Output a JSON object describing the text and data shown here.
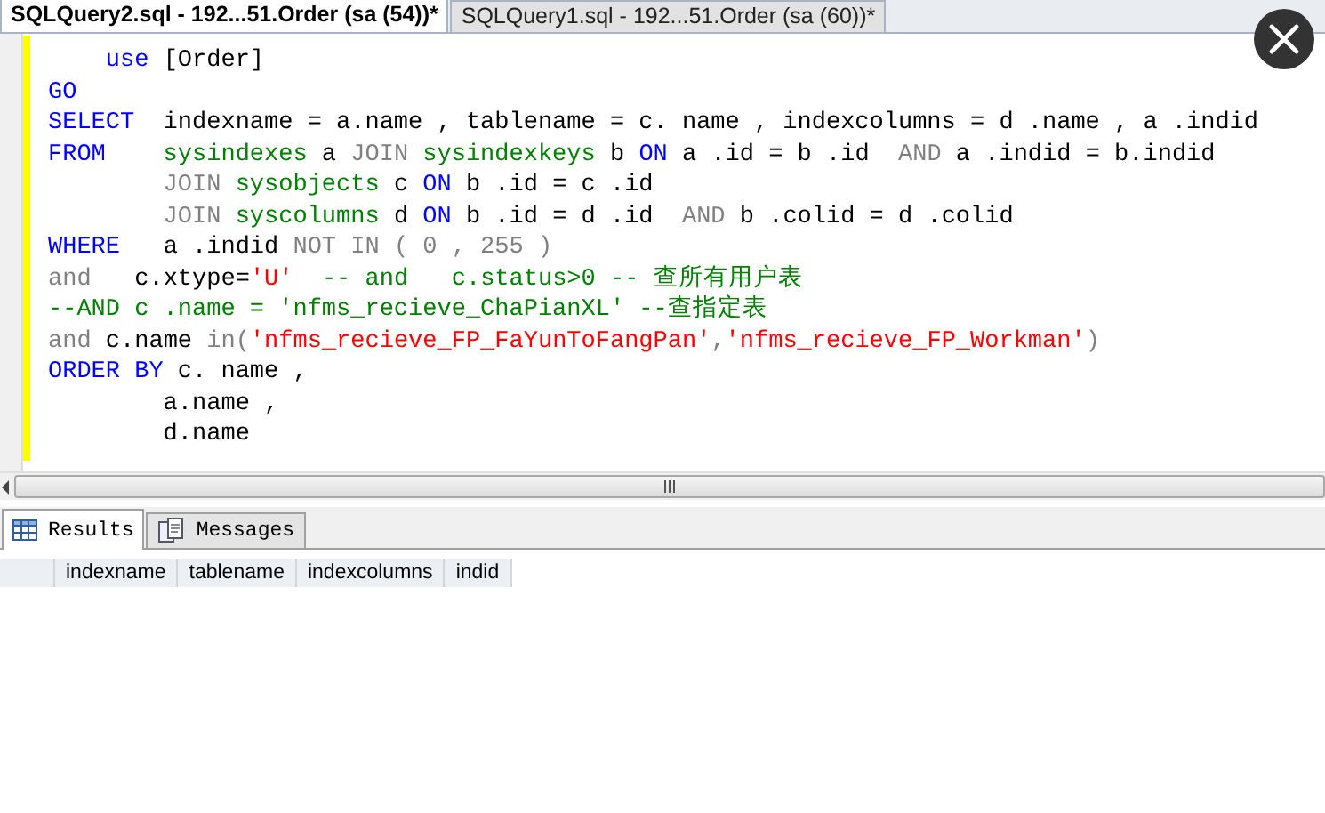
{
  "tabs": [
    {
      "label": "SQLQuery2.sql - 192...51.Order (sa (54))*",
      "selected": true
    },
    {
      "label": "SQLQuery1.sql - 192...51.Order (sa (60))*",
      "selected": false
    }
  ],
  "editor": {
    "lines": [
      [
        {
          "kind": "keyword",
          "text": "    use"
        },
        {
          "kind": "plain",
          "text": " [Order]"
        }
      ],
      [
        {
          "kind": "keyword",
          "text": "GO"
        }
      ],
      [
        {
          "kind": "keyword",
          "text": "SELECT"
        },
        {
          "kind": "plain",
          "text": "  indexname = a.name , tablename = c. name , indexcolumns = d .name , a .indid"
        }
      ],
      [
        {
          "kind": "keyword",
          "text": "FROM"
        },
        {
          "kind": "object",
          "text": "    sysindexes"
        },
        {
          "kind": "plain",
          "text": " a "
        },
        {
          "kind": "operator",
          "text": "JOIN"
        },
        {
          "kind": "object",
          "text": " sysindexkeys"
        },
        {
          "kind": "plain",
          "text": " b "
        },
        {
          "kind": "keyword",
          "text": "ON"
        },
        {
          "kind": "plain",
          "text": " a .id = b .id  "
        },
        {
          "kind": "operator",
          "text": "AND"
        },
        {
          "kind": "plain",
          "text": " a .indid = b.indid"
        }
      ],
      [
        {
          "kind": "operator",
          "text": "        JOIN"
        },
        {
          "kind": "object",
          "text": " sysobjects"
        },
        {
          "kind": "plain",
          "text": " c "
        },
        {
          "kind": "keyword",
          "text": "ON"
        },
        {
          "kind": "plain",
          "text": " b .id = c .id"
        }
      ],
      [
        {
          "kind": "operator",
          "text": "        JOIN"
        },
        {
          "kind": "object",
          "text": " syscolumns"
        },
        {
          "kind": "plain",
          "text": " d "
        },
        {
          "kind": "keyword",
          "text": "ON"
        },
        {
          "kind": "plain",
          "text": " b .id = d .id  "
        },
        {
          "kind": "operator",
          "text": "AND"
        },
        {
          "kind": "plain",
          "text": " b .colid = d .colid"
        }
      ],
      [
        {
          "kind": "keyword",
          "text": "WHERE"
        },
        {
          "kind": "plain",
          "text": "   a .indid "
        },
        {
          "kind": "operator",
          "text": "NOT IN ( 0 , 255 )"
        }
      ],
      [
        {
          "kind": "operator",
          "text": "and"
        },
        {
          "kind": "plain",
          "text": "   c.xtype="
        },
        {
          "kind": "string",
          "text": "'U'"
        },
        {
          "kind": "comment",
          "text": "  -- and   c.status>0 -- 查所有用户表"
        }
      ],
      [
        {
          "kind": "comment",
          "text": "--AND c .name = 'nfms_recieve_ChaPianXL' --查指定表"
        }
      ],
      [
        {
          "kind": "operator",
          "text": "and"
        },
        {
          "kind": "plain",
          "text": " c.name "
        },
        {
          "kind": "operator",
          "text": "in("
        },
        {
          "kind": "string",
          "text": "'nfms_recieve_FP_FaYunToFangPan'"
        },
        {
          "kind": "operator",
          "text": ","
        },
        {
          "kind": "string",
          "text": "'nfms_recieve_FP_Workman'"
        },
        {
          "kind": "operator",
          "text": ")"
        }
      ],
      [
        {
          "kind": "keyword",
          "text": "ORDER BY"
        },
        {
          "kind": "plain",
          "text": " c. name ,"
        }
      ],
      [
        {
          "kind": "plain",
          "text": "        a.name ,"
        }
      ],
      [
        {
          "kind": "plain",
          "text": "        d.name"
        }
      ]
    ]
  },
  "results": {
    "tabs": [
      {
        "label": "Results",
        "selected": true,
        "kind": "grid"
      },
      {
        "label": "Messages",
        "selected": false,
        "kind": "messages"
      }
    ],
    "columns": [
      "indexname",
      "tablename",
      "indexcolumns",
      "indid"
    ]
  }
}
